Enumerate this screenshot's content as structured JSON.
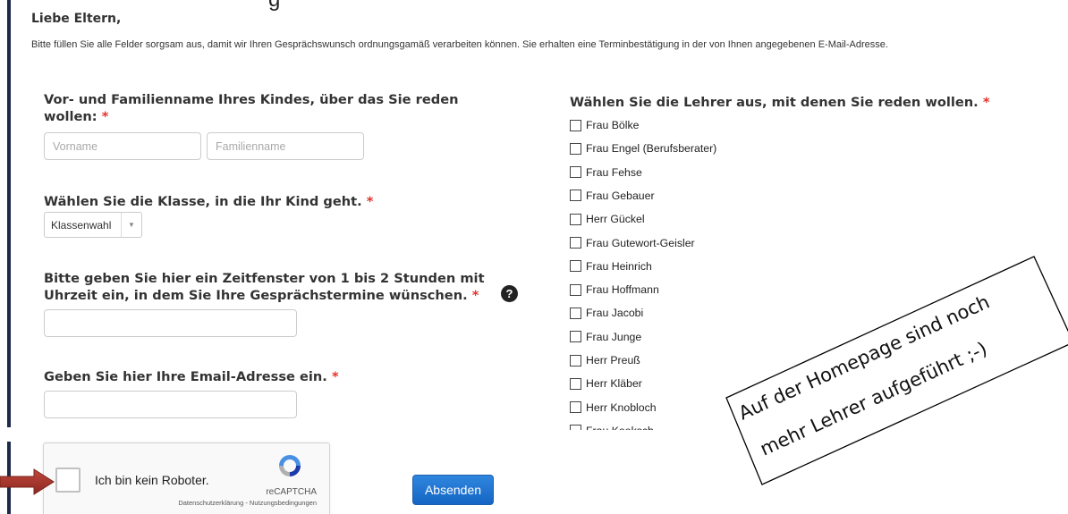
{
  "header": {
    "cut_heading": "g",
    "greeting": "Liebe Eltern,",
    "intro": "Bitte füllen Sie alle Felder sorgsam aus, damit wir Ihren Gesprächswunsch ordnungsgamäß verarbeiten können. Sie erhalten eine Terminbestätigung in der von Ihnen angegebenen E-Mail-Adresse."
  },
  "form": {
    "child_name": {
      "label_line1": "Vor- und Familienname Ihres Kindes, über das Sie reden",
      "label_line2": "wollen:",
      "required_mark": "*",
      "first_placeholder": "Vorname",
      "last_placeholder": "Familienname"
    },
    "class_select": {
      "label": "Wählen Sie die Klasse, in die Ihr Kind geht.",
      "required_mark": "*",
      "value": "Klassenwahl",
      "arrow_icon": "chevron-down-icon"
    },
    "timeframe": {
      "label_line1": "Bitte geben Sie hier ein Zeitfenster von 1 bis 2 Stunden mit",
      "label_line2": "Uhrzeit ein, in dem Sie Ihre Gesprächstermine wünschen.",
      "required_mark": "*",
      "help_icon": "?",
      "value": ""
    },
    "email": {
      "label": "Geben Sie hier Ihre Email-Adresse ein.",
      "required_mark": "*",
      "value": ""
    },
    "teachers": {
      "label": "Wählen Sie die Lehrer aus, mit denen Sie reden wollen.",
      "required_mark": "*",
      "items": [
        "Frau Bölke",
        "Frau Engel (Berufsberater)",
        "Frau Fehse",
        "Frau Gebauer",
        "Herr Gückel",
        "Frau Gutewort-Geisler",
        "Frau Heinrich",
        "Frau Hoffmann",
        "Frau Jacobi",
        "Frau Junge",
        "Herr Preuß",
        "Herr Kläber",
        "Herr Knobloch",
        "Frau Koeksch"
      ]
    },
    "captcha": {
      "label": "Ich bin kein Roboter.",
      "brand": "reCAPTCHA",
      "terms": "Datenschutzerklärung - Nutzungsbedingungen",
      "logo_icon": "recaptcha-logo-icon"
    },
    "submit_label": "Absenden"
  },
  "annotation": {
    "line1": "Auf der Homepage  sind noch",
    "line2": "mehr Lehrer aufgeführt ;-)",
    "arrow_color": "#a8342c"
  },
  "colors": {
    "required": "#e4322b",
    "button": "#1f73cf",
    "left_bar": "#1c2a4a"
  }
}
